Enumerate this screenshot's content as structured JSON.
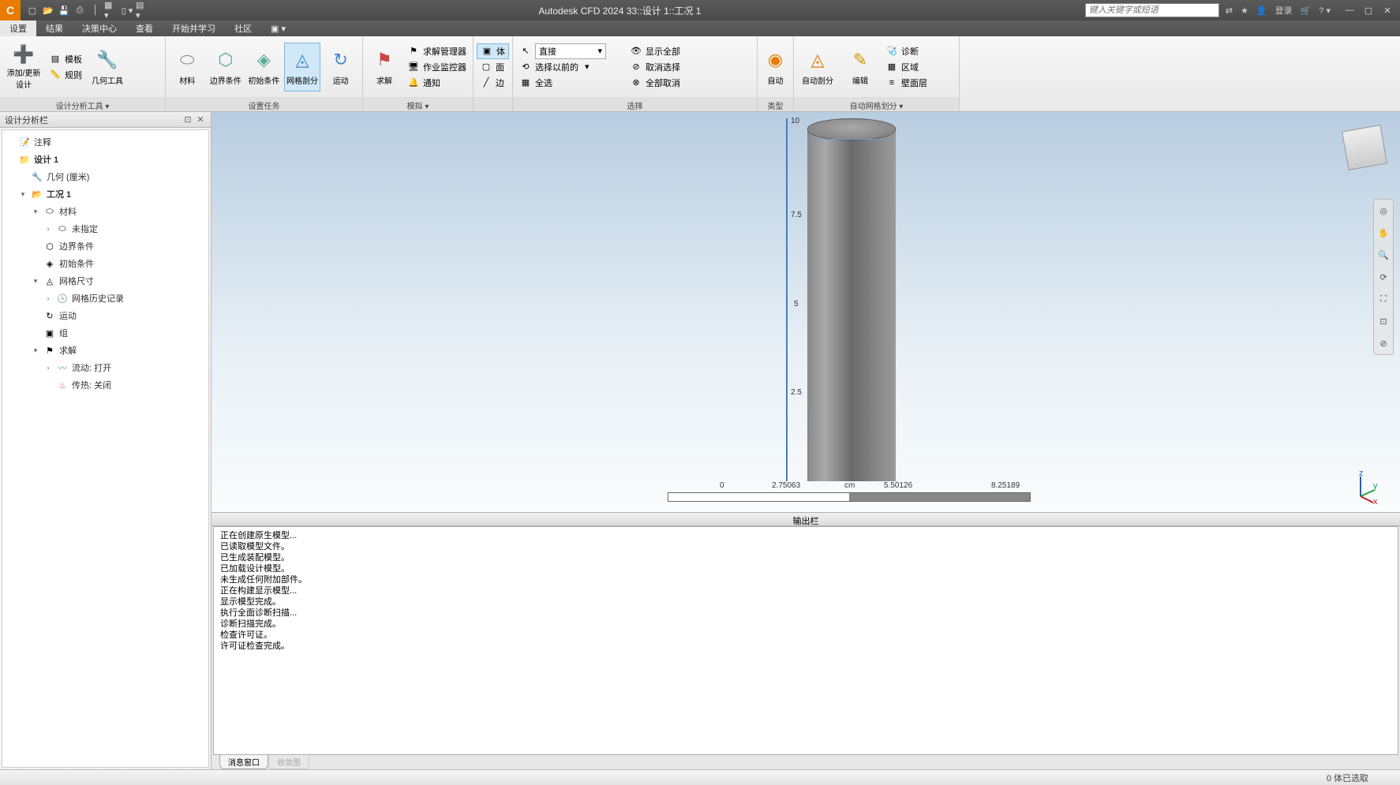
{
  "app_icon": "C",
  "title": "Autodesk CFD 2024   33::设计 1::工况 1",
  "search_placeholder": "键入关键字或短语",
  "login_label": "登录",
  "menubar": [
    "设置",
    "结果",
    "决策中心",
    "查看",
    "开始并学习",
    "社区"
  ],
  "ribbon": {
    "g1": {
      "label": "设计分析工具 ▾",
      "add": "添加/更新设计",
      "tpl": "模板",
      "rule": "规则",
      "geom": "几何工具"
    },
    "g2": {
      "label": "设置任务",
      "mat": "材料",
      "bc": "边界条件",
      "ic": "初始条件",
      "mesh": "网格剖分",
      "motion": "运动"
    },
    "g3": {
      "label": "模拟 ▾",
      "solve": "求解",
      "sm": "求解管理器",
      "jm": "作业监控器",
      "notify": "通知"
    },
    "g4": {
      "body": "体",
      "face": "面",
      "edge": "边"
    },
    "g5": {
      "label": "选择",
      "direct": "直接",
      "before": "选择以前的",
      "all": "全选",
      "showall": "显示全部",
      "cancelsel": "取消选择",
      "cancelall": "全部取消"
    },
    "g6": {
      "label": "类型",
      "auto": "自动"
    },
    "g7": {
      "label": "自动网格划分 ▾",
      "automesh": "自动剖分",
      "edit": "编辑",
      "diag": "诊断",
      "region": "区域",
      "wall": "壁面层"
    }
  },
  "panel_title": "设计分析栏",
  "tree": {
    "note": "注释",
    "design": "设计 1",
    "geom": "几何 (厘米)",
    "case": "工况 1",
    "mat": "材料",
    "unspec": "未指定",
    "bc": "边界条件",
    "ic": "初始条件",
    "meshsize": "网格尺寸",
    "meshhist": "网格历史记录",
    "motion": "运动",
    "group": "组",
    "solve": "求解",
    "flow": "流动: 打开",
    "heat": "传热: 关闭"
  },
  "viewport": {
    "ticks_v": [
      "10",
      "7.5",
      "5",
      "2.5"
    ],
    "scale": {
      "start": "0",
      "q1": "2.75063",
      "unit": "cm",
      "q2": "5.50126",
      "end": "8.25189"
    },
    "axes": {
      "x": "x",
      "y": "y",
      "z": "z"
    }
  },
  "output_title": "输出栏",
  "output_lines": [
    "正在创建原生模型...",
    "已读取模型文件。",
    "已生成装配模型。",
    "已加载设计模型。",
    "未生成任何附加部件。",
    "正在构建显示模型...",
    "显示模型完成。",
    "执行全面诊断扫描...",
    "诊断扫描完成。",
    "检查许可证。",
    "许可证检查完成。"
  ],
  "output_tabs": {
    "msg": "消息窗口",
    "conv": "收敛图"
  },
  "status": "0 体已选取"
}
